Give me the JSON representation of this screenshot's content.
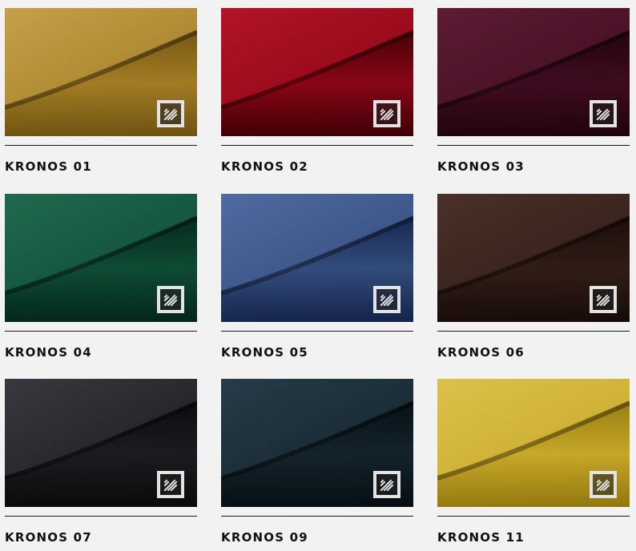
{
  "swatches": [
    {
      "name": "KRONOS 01",
      "color": "#a27d24",
      "light": "#c4a04a",
      "dark": "#6f5212"
    },
    {
      "name": "KRONOS 02",
      "color": "#8a0616",
      "light": "#b21426",
      "dark": "#3d0006"
    },
    {
      "name": "KRONOS 03",
      "color": "#3f0c20",
      "light": "#5c1c34",
      "dark": "#1f030d"
    },
    {
      "name": "KRONOS 04",
      "color": "#0e4b35",
      "light": "#20694e",
      "dark": "#04261a"
    },
    {
      "name": "KRONOS 05",
      "color": "#334c7c",
      "light": "#506aa0",
      "dark": "#14234a"
    },
    {
      "name": "KRONOS 06",
      "color": "#311d17",
      "light": "#4a3028",
      "dark": "#170b07"
    },
    {
      "name": "KRONOS 07",
      "color": "#1c1c20",
      "light": "#38383e",
      "dark": "#0a0a0c"
    },
    {
      "name": "KRONOS 09",
      "color": "#14232c",
      "light": "#263c48",
      "dark": "#060e13"
    },
    {
      "name": "KRONOS 11",
      "color": "#c7a829",
      "light": "#dcc04a",
      "dark": "#92770f"
    }
  ],
  "logo_icon": "fabric-brand-logo-icon"
}
